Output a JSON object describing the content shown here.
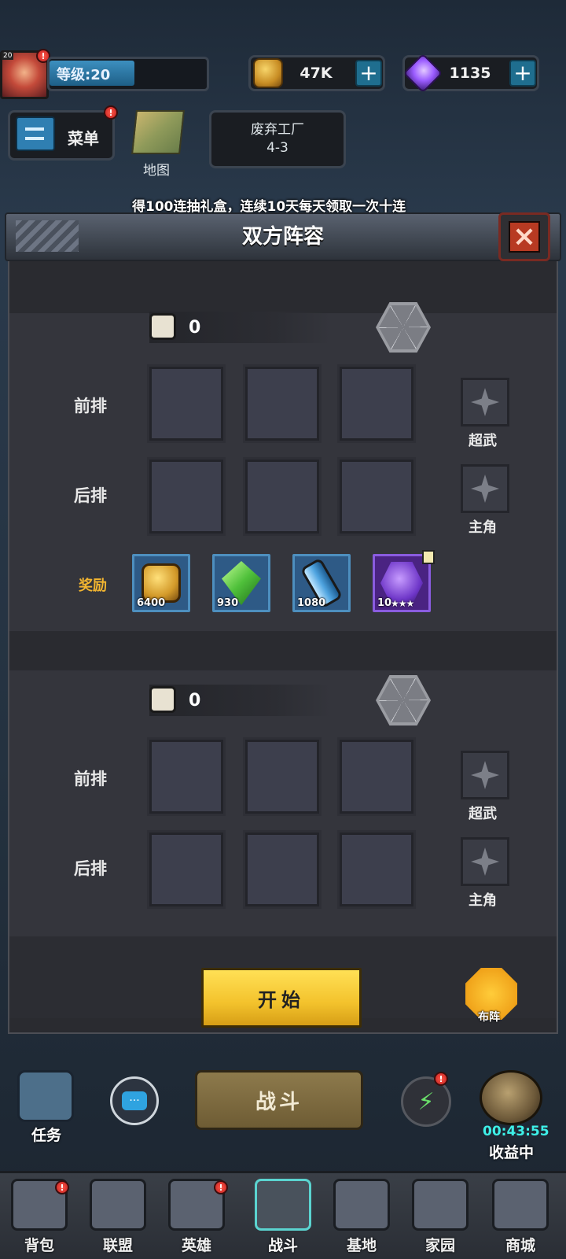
{
  "hud": {
    "avatar_level": "20",
    "level_label": "等级:20",
    "level_progress": 0.55,
    "coins": "47K",
    "gems": "1135",
    "plus": "+",
    "alert": "!"
  },
  "menu": {
    "menu_label": "菜单",
    "map_label": "地图",
    "stage_name": "废弃工厂",
    "stage_number": "4-3"
  },
  "marquee": "得100连抽礼盒，连续10天每天领取一次十连",
  "dialog": {
    "title": "双方阵容",
    "close": "×",
    "teams": [
      {
        "power": "0",
        "front_row": "前排",
        "back_row": "后排",
        "super_weapon": "超武",
        "protagonist": "主角"
      },
      {
        "power": "0",
        "front_row": "前排",
        "back_row": "后排",
        "super_weapon": "超武",
        "protagonist": "主角"
      }
    ],
    "reward_label": "奖励",
    "rewards": [
      {
        "icon": "gold-coin-icon",
        "count": "6400"
      },
      {
        "icon": "green-crystal-icon",
        "count": "930"
      },
      {
        "icon": "blue-vial-icon",
        "count": "1080"
      },
      {
        "icon": "purple-shard-icon",
        "count": "10",
        "stars": "★★★"
      }
    ],
    "start_label": "开始",
    "formation_label": "布阵"
  },
  "bottom_hud": {
    "task_label": "任务",
    "chat_icon": "···",
    "battle_label": "战斗",
    "lightning_icon": "⚡",
    "timer": "00:43:55",
    "income_label": "收益中"
  },
  "nav": [
    {
      "label": "背包",
      "icon": "backpack-icon"
    },
    {
      "label": "联盟",
      "icon": "alliance-icon"
    },
    {
      "label": "英雄",
      "icon": "hero-icon"
    },
    {
      "label": "战斗",
      "icon": "battle-icon",
      "active": true
    },
    {
      "label": "基地",
      "icon": "base-icon"
    },
    {
      "label": "家园",
      "icon": "home-icon"
    },
    {
      "label": "商城",
      "icon": "shop-icon"
    }
  ],
  "colors": {
    "accent_yellow": "#f3c22c",
    "reward_label": "#f2b530",
    "timer": "#3ef0e8",
    "close_red": "#b83a22"
  }
}
